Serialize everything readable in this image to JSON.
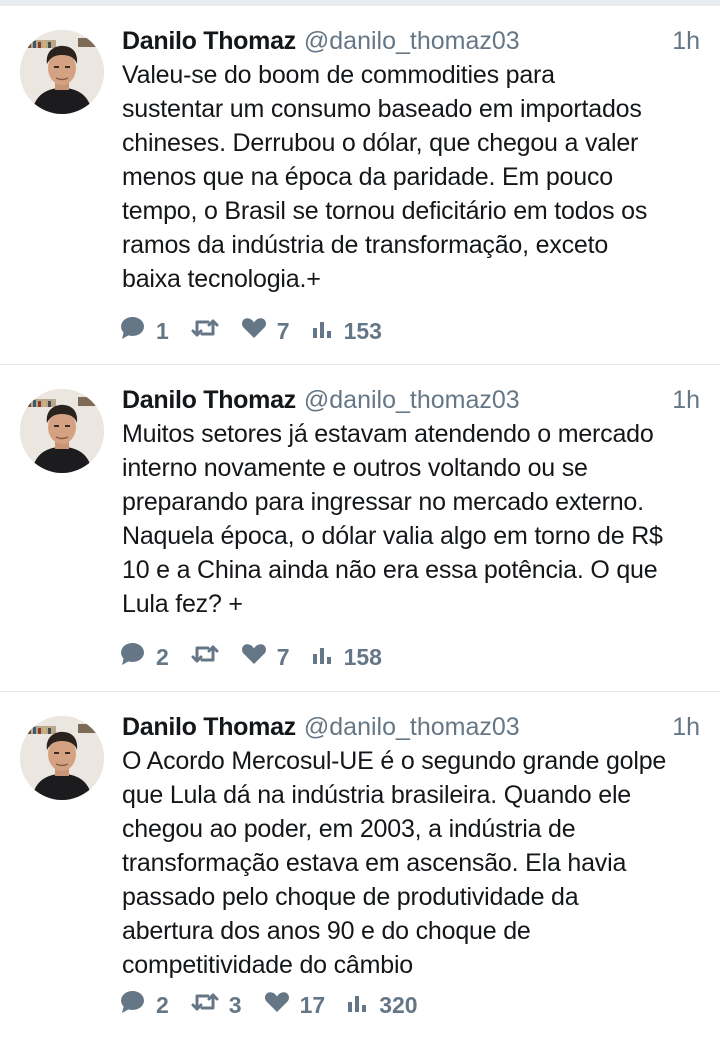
{
  "colors": {
    "text": "#14171a",
    "secondary": "#657786",
    "divider": "#e1e8ed",
    "top_strip": "#e6ecf0"
  },
  "icons": {
    "reply": "speech-bubble-icon",
    "retweet": "retweet-arrows-icon",
    "like": "heart-icon",
    "analytics": "bar-chart-icon"
  },
  "tweets": [
    {
      "display_name": "Danilo Thomaz",
      "handle": "@danilo_thomaz03",
      "time": "1h",
      "lines": [
        "Valeu-se do boom de commodities para",
        "sustentar um consumo baseado em importados",
        "chineses. Derrubou o dólar, que chegou a valer",
        "menos que na época da paridade. Em pouco",
        "tempo, o Brasil se tornou deficitário em todos os",
        "ramos da indústria de transformação, exceto",
        "baixa tecnologia.+"
      ],
      "replies": "1",
      "retweets": "",
      "likes": "7",
      "views": "153"
    },
    {
      "display_name": "Danilo Thomaz",
      "handle": "@danilo_thomaz03",
      "time": "1h",
      "lines": [
        "Muitos setores já estavam atendendo o mercado",
        "interno novamente e outros voltando ou se",
        "preparando para ingressar no mercado externo.",
        "Naquela época, o dólar valia algo em torno de R$",
        "10 e a China ainda não era essa potência. O que",
        "Lula fez? +"
      ],
      "replies": "2",
      "retweets": "",
      "likes": "7",
      "views": "158"
    },
    {
      "display_name": "Danilo Thomaz",
      "handle": "@danilo_thomaz03",
      "time": "1h",
      "lines": [
        "O Acordo Mercosul-UE é o segundo grande golpe",
        "que Lula dá na indústria brasileira. Quando ele",
        "chegou ao poder, em 2003, a indústria de",
        "transformação estava em ascensão. Ela havia",
        "passado pelo choque de produtividade da",
        "abertura dos anos 90 e do choque de",
        "competitividade do câmbio"
      ],
      "replies": "2",
      "retweets": "3",
      "likes": "17",
      "views": "320"
    }
  ]
}
